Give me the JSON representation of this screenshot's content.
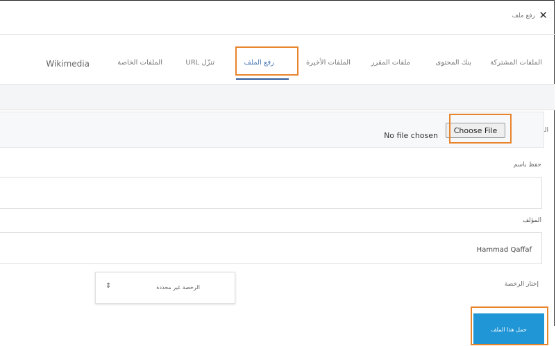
{
  "dialog": {
    "title": "رفع ملف",
    "close_icon": "close-icon"
  },
  "tabs": [
    {
      "label": "الملفات المشتركة"
    },
    {
      "label": "بنك المحتوى"
    },
    {
      "label": "ملفات المقرر"
    },
    {
      "label": "الملفات الأخيرة"
    },
    {
      "label": "رفع الملف",
      "active": true
    },
    {
      "label": "URL تنزّل"
    },
    {
      "label": "الملفات الخاصة"
    },
    {
      "label": "Wikimedia"
    }
  ],
  "form": {
    "attachment_label": "المرفق",
    "file_status": "No file chosen",
    "choose_file_label": "Choose File",
    "save_as_label": "حفظ باسم",
    "save_as_value": "",
    "author_label": "المؤلف",
    "author_value": "Hammad Qaffaf",
    "license_label": "إختار الرخصة",
    "license_value": "الرخصة غير محددة",
    "upload_button_label": "حمل هذا الملف"
  },
  "colors": {
    "highlight": "#e8842c",
    "active_tab": "#2e5a99",
    "upload_button": "#2196d6"
  }
}
